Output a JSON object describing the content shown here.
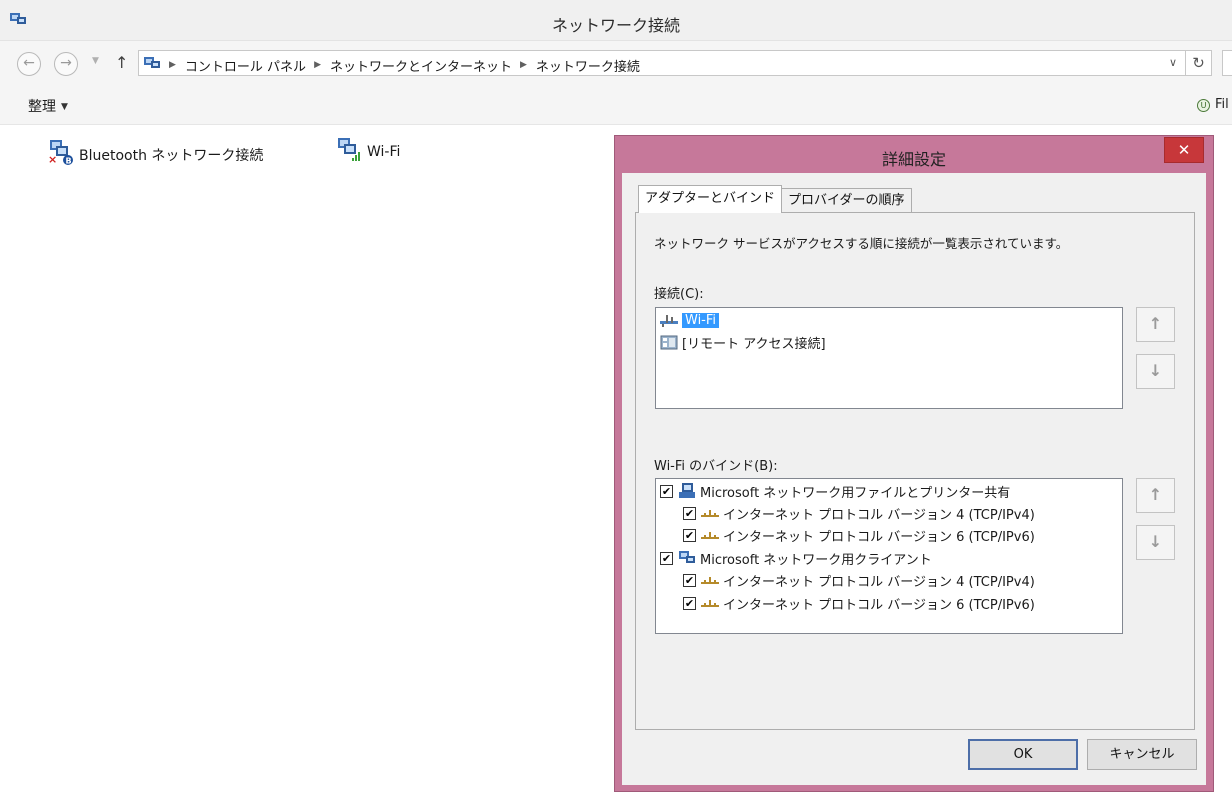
{
  "window": {
    "title": "ネットワーク接続"
  },
  "address": {
    "breadcrumbs": [
      "コントロール パネル",
      "ネットワークとインターネット",
      "ネットワーク接続"
    ]
  },
  "toolbar": {
    "organize_label": "整理",
    "filter_label": "Fil"
  },
  "connections": [
    {
      "name": "Bluetooth ネットワーク接続",
      "icon": "bluetooth-network-icon"
    },
    {
      "name": "Wi-Fi",
      "icon": "wifi-network-icon"
    }
  ],
  "dialog": {
    "title": "詳細設定",
    "close_label": "✕",
    "tabs": [
      "アダプターとバインド",
      "プロバイダーの順序"
    ],
    "description": "ネットワーク サービスがアクセスする順に接続が一覧表示されています。",
    "connections_label": "接続(C):",
    "connection_items": [
      {
        "label": "Wi-Fi",
        "selected": true
      },
      {
        "label": "[リモート アクセス接続]",
        "selected": false
      }
    ],
    "bindings_label": "Wi-Fi のバインド(B):",
    "bindings": [
      {
        "label": "Microsoft ネットワーク用ファイルとプリンター共有",
        "checked": true
      },
      {
        "label": "インターネット プロトコル バージョン 4 (TCP/IPv4)",
        "checked": true
      },
      {
        "label": "インターネット プロトコル バージョン 6 (TCP/IPv6)",
        "checked": true
      },
      {
        "label": "Microsoft ネットワーク用クライアント",
        "checked": true
      },
      {
        "label": "インターネット プロトコル バージョン 4 (TCP/IPv4)",
        "checked": true
      },
      {
        "label": "インターネット プロトコル バージョン 6 (TCP/IPv6)",
        "checked": true
      }
    ],
    "move_up_label": "↑",
    "move_down_label": "↓",
    "ok_label": "OK",
    "cancel_label": "キャンセル"
  },
  "colors": {
    "dialog_frame": "#c6789a",
    "close_button": "#c7373a",
    "selection": "#3399ff"
  }
}
